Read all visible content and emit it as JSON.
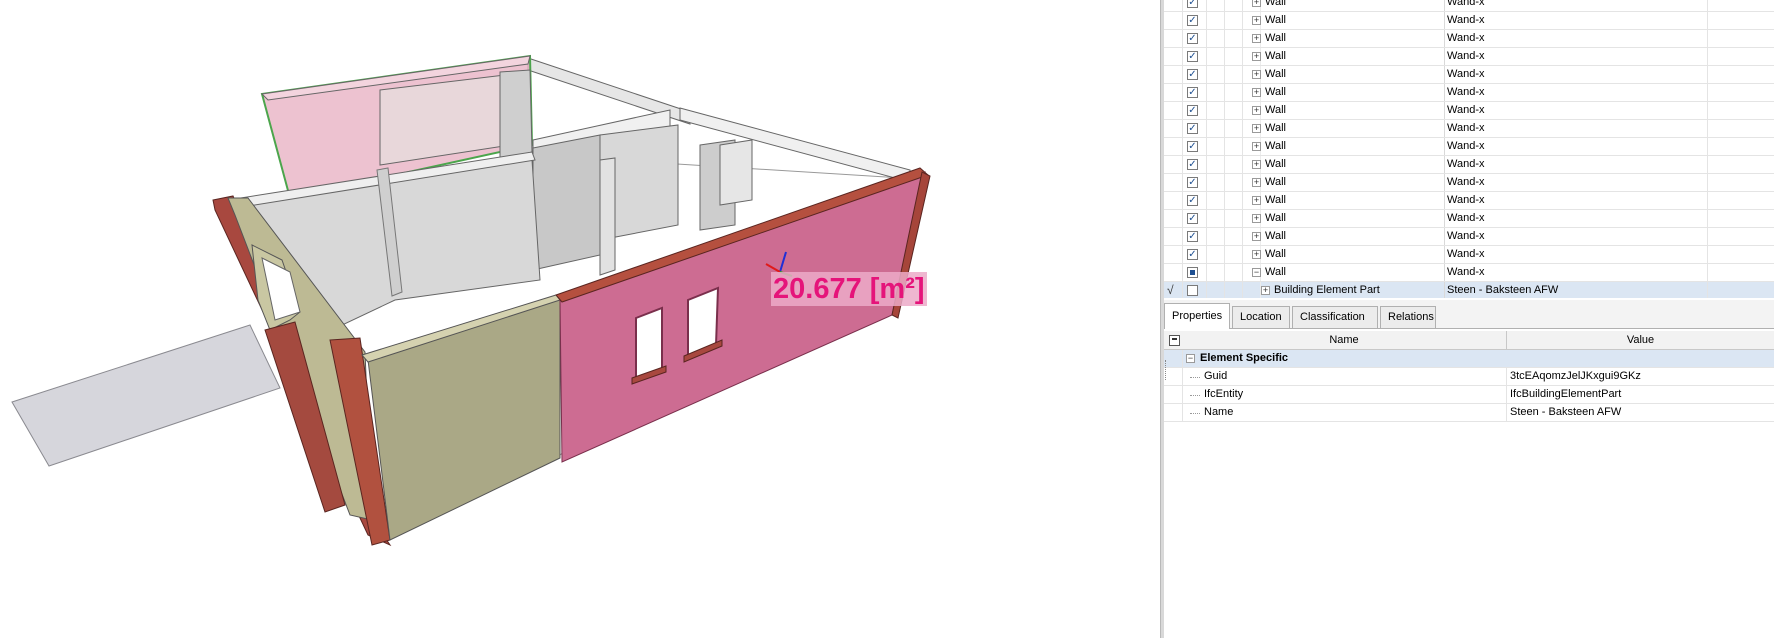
{
  "viewport": {
    "measurement": "20.677 [m²]"
  },
  "tree": {
    "rows": [
      {
        "name": "Wall",
        "value": "Wand-x",
        "checked": true,
        "expander": "+",
        "indent": 3
      },
      {
        "name": "Wall",
        "value": "Wand-x",
        "checked": true,
        "expander": "+",
        "indent": 3
      },
      {
        "name": "Wall",
        "value": "Wand-x",
        "checked": true,
        "expander": "+",
        "indent": 3
      },
      {
        "name": "Wall",
        "value": "Wand-x",
        "checked": true,
        "expander": "+",
        "indent": 3
      },
      {
        "name": "Wall",
        "value": "Wand-x",
        "checked": true,
        "expander": "+",
        "indent": 3
      },
      {
        "name": "Wall",
        "value": "Wand-x",
        "checked": true,
        "expander": "+",
        "indent": 3
      },
      {
        "name": "Wall",
        "value": "Wand-x",
        "checked": true,
        "expander": "+",
        "indent": 3
      },
      {
        "name": "Wall",
        "value": "Wand-x",
        "checked": true,
        "expander": "+",
        "indent": 3
      },
      {
        "name": "Wall",
        "value": "Wand-x",
        "checked": true,
        "expander": "+",
        "indent": 3
      },
      {
        "name": "Wall",
        "value": "Wand-x",
        "checked": true,
        "expander": "+",
        "indent": 3
      },
      {
        "name": "Wall",
        "value": "Wand-x",
        "checked": true,
        "expander": "+",
        "indent": 3
      },
      {
        "name": "Wall",
        "value": "Wand-x",
        "checked": true,
        "expander": "+",
        "indent": 3
      },
      {
        "name": "Wall",
        "value": "Wand-x",
        "checked": true,
        "expander": "+",
        "indent": 3
      },
      {
        "name": "Wall",
        "value": "Wand-x",
        "checked": true,
        "expander": "+",
        "indent": 3
      },
      {
        "name": "Wall",
        "value": "Wand-x",
        "checked": true,
        "expander": "+",
        "indent": 3
      },
      {
        "name": "Wall",
        "value": "Wand-x",
        "checked": "partial",
        "expander": "−",
        "indent": 3
      },
      {
        "name": "Building Element Part",
        "value": "Steen - Baksteen AFW",
        "checked": false,
        "expander": "+",
        "indent": 4,
        "selected": true,
        "mark": "√"
      }
    ],
    "grip": "....."
  },
  "tabs": [
    {
      "label": "Properties",
      "active": true
    },
    {
      "label": "Location",
      "active": false
    },
    {
      "label": "Classification",
      "active": false
    },
    {
      "label": "Relations",
      "active": false
    }
  ],
  "properties": {
    "header_name": "Name",
    "header_value": "Value",
    "group": {
      "label": "Element Specific",
      "expander": "−"
    },
    "rows": [
      {
        "name": "Guid",
        "value": "3tcEAqomzJelJKxgui9GKz"
      },
      {
        "name": "IfcEntity",
        "value": "IfcBuildingElementPart"
      },
      {
        "name": "Name",
        "value": "Steen - Baksteen AFW"
      }
    ]
  },
  "colors": {
    "highlight_wall": "#cd6c92",
    "measure_text": "#e5147a",
    "wall_tan": "#aaa886",
    "wall_edge_red": "#a8483f",
    "selection_row": "#dbe6f3"
  }
}
